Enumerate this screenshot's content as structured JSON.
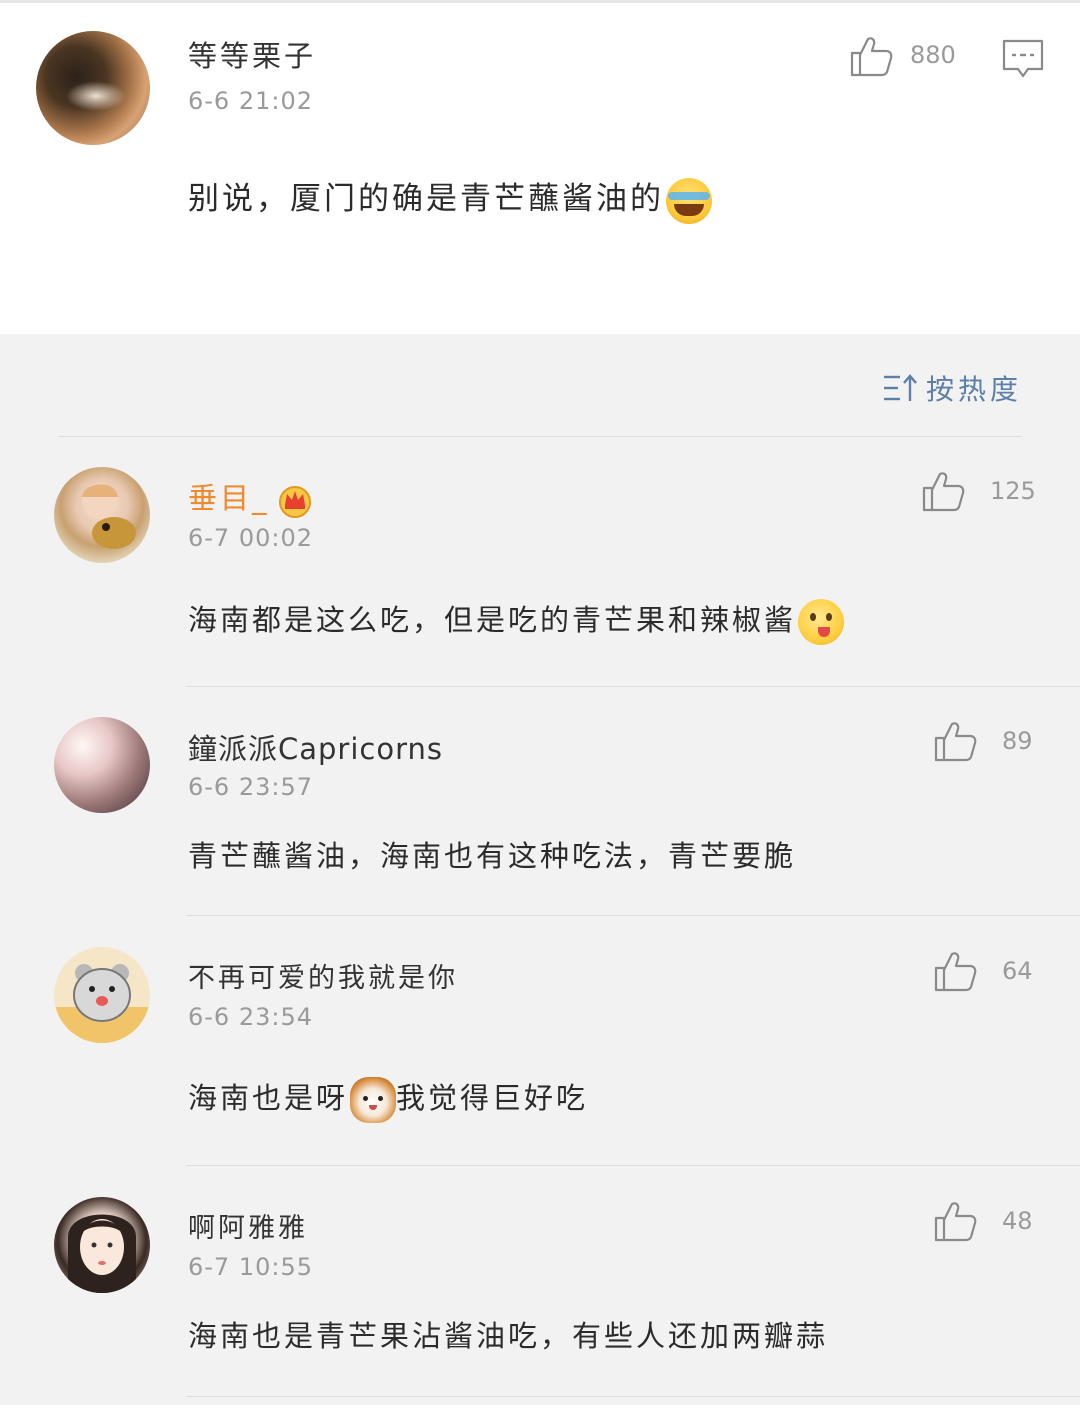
{
  "main_comment": {
    "username": "等等栗子",
    "timestamp": "6-6 21:02",
    "text": "别说，厦门的确是青芒蘸酱油的",
    "likes": "880",
    "emoji": "laughing-tears-emoji"
  },
  "sort": {
    "label": "按热度"
  },
  "replies": [
    {
      "username": "垂目_",
      "timestamp": "6-7 00:02",
      "text": "海南都是这么吃，但是吃的青芒果和辣椒酱",
      "likes": "125",
      "username_color": "#f08a2e",
      "badge": "vip-crown-icon",
      "emoji": "tongue-out-emoji"
    },
    {
      "username": "鐘派派Capricorns",
      "timestamp": "6-6 23:57",
      "text": "青芒蘸酱油，海南也有这种吃法，青芒要脆",
      "likes": "89"
    },
    {
      "username": "不再可爱的我就是你",
      "timestamp": "6-6 23:54",
      "text_before": "海南也是呀",
      "text_after": "我觉得巨好吃",
      "likes": "64",
      "emoji": "cat-emoji"
    },
    {
      "username": "啊阿雅雅",
      "timestamp": "6-7 10:55",
      "text": "海南也是青芒果沾酱油吃，有些人还加两瓣蒜",
      "likes": "48"
    }
  ],
  "colors": {
    "accent": "#5b7fa8",
    "vip_name": "#f08a2e",
    "secondary_text": "#9a9a9a"
  }
}
